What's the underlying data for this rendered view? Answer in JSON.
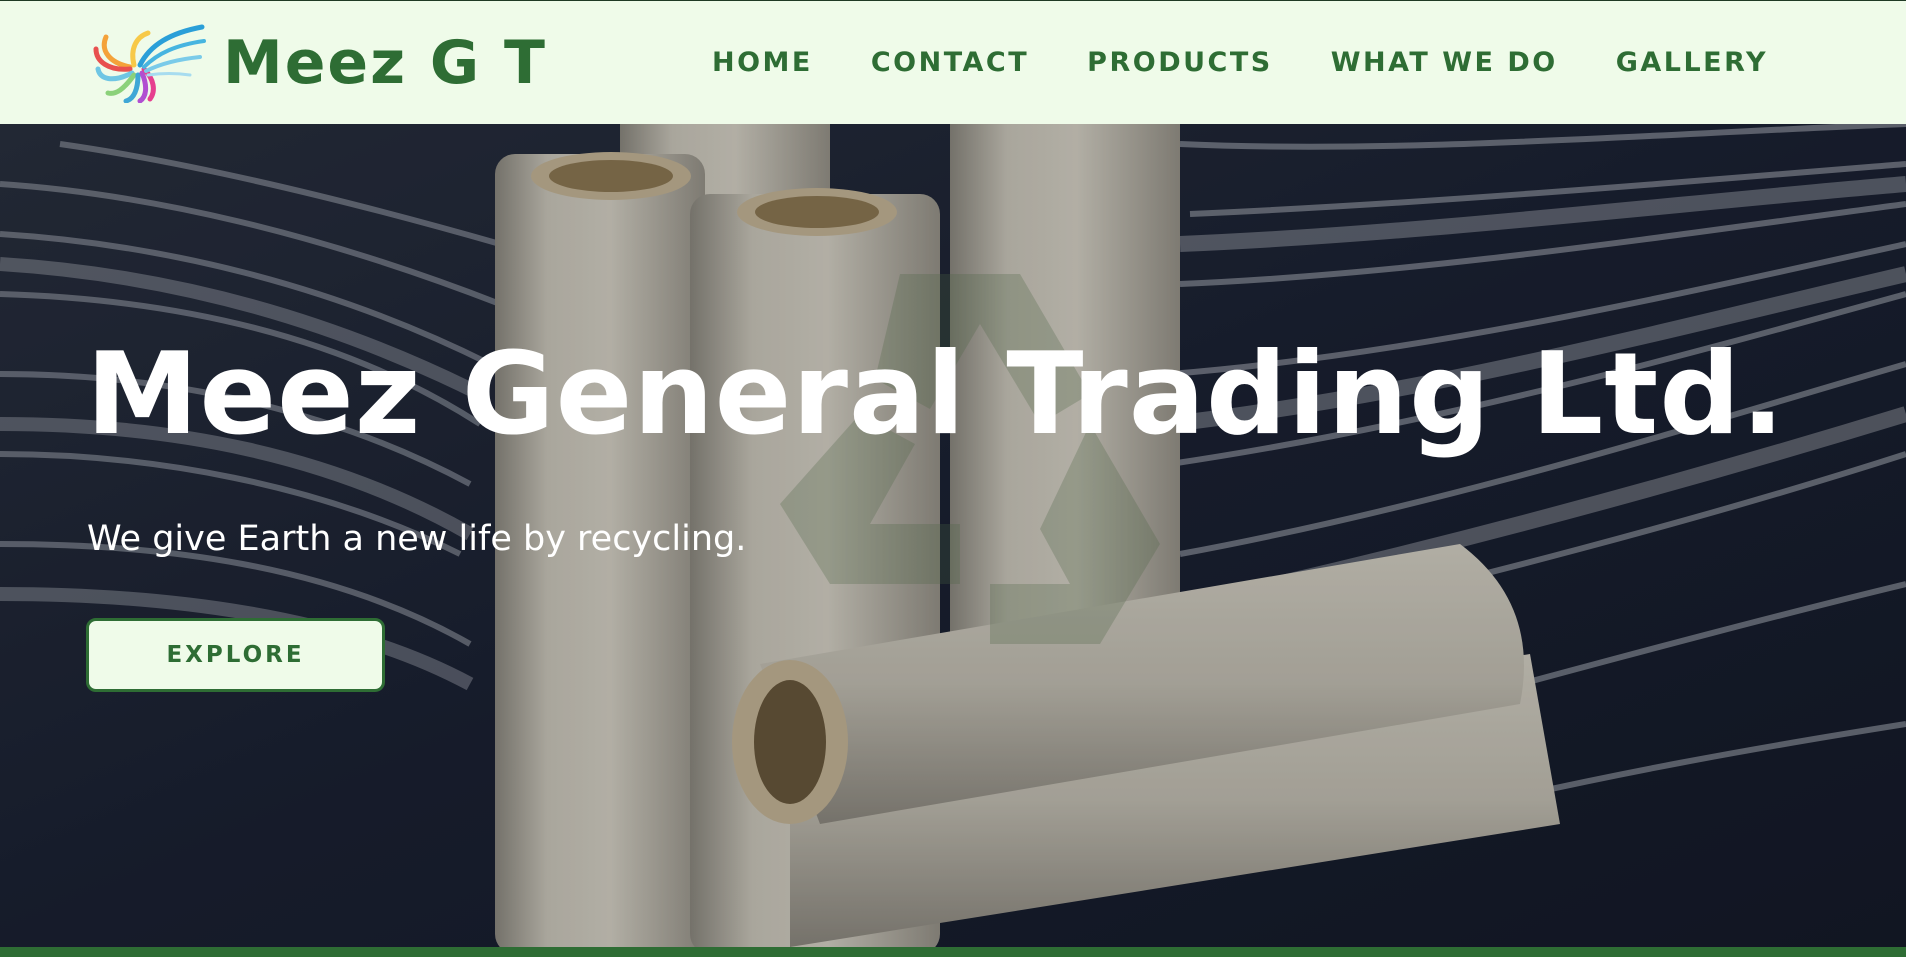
{
  "header": {
    "brand": "Meez G T",
    "logo_icon": "feather-swirl-logo-icon"
  },
  "nav": {
    "items": [
      "HOME",
      "CONTACT",
      "PRODUCTS",
      "WHAT WE DO",
      "GALLERY"
    ]
  },
  "hero": {
    "title": "Meez General Trading Ltd.",
    "subtitle": "We give Earth a new life by recycling.",
    "cta_label": "EXPLORE",
    "background": "stretch-film-rolls-photo",
    "watermark_icon": "recycle-icon"
  },
  "colors": {
    "brand_green": "#2e6d34",
    "header_bg": "#effbe9",
    "hero_dark": "#1d2433",
    "hero_text": "#ffffff"
  }
}
